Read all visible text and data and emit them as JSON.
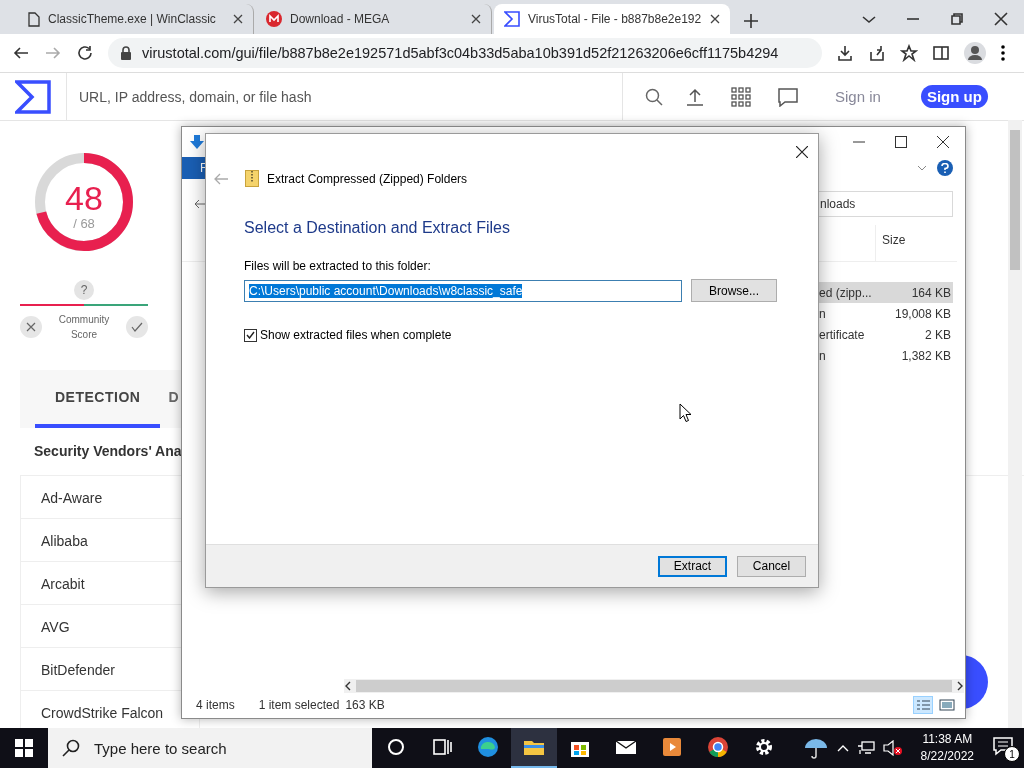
{
  "browser": {
    "tabs": [
      {
        "title": "ClassicTheme.exe | WinClassic",
        "kind": "page",
        "selected": false
      },
      {
        "title": "Download - MEGA",
        "kind": "mega",
        "selected": false
      },
      {
        "title": "VirusTotal - File - b887b8e2e192",
        "kind": "vt",
        "selected": true
      }
    ],
    "url": "virustotal.com/gui/file/b887b8e2e192571d5abf3c04b33d5aba10b391d52f21263206e6cff1175b4294"
  },
  "vt": {
    "search": {
      "placeholder": "URL, IP address, domain, or file hash"
    },
    "sign_in": "Sign in",
    "sign_up": "Sign up",
    "score": {
      "detections": "48",
      "total": "/ 68",
      "level": 0.71
    },
    "community": {
      "badge": "?",
      "label": "Community Score"
    },
    "tabs": [
      {
        "label": "DETECTION",
        "selected": true
      },
      {
        "label": "D",
        "selected": false
      }
    ],
    "section_title": "Security Vendors' Ana",
    "vendors": [
      "Ad-Aware",
      "Alibaba",
      "Arcabit",
      "AVG",
      "BitDefender",
      "CrowdStrike Falcon"
    ]
  },
  "explorer": {
    "ribbon_tab": "F",
    "search": {
      "value": "nloads"
    },
    "column": "Size",
    "rows": [
      {
        "name": "ed (zipp...",
        "size": "164 KB",
        "selected": true
      },
      {
        "name": "n",
        "size": "19,008 KB",
        "selected": false
      },
      {
        "name": "ertificate",
        "size": "2 KB",
        "selected": false
      },
      {
        "name": "n",
        "size": "1,382 KB",
        "selected": false
      }
    ],
    "status": {
      "items": "4 items",
      "selected": "1 item selected",
      "size": "163 KB"
    }
  },
  "dialog": {
    "title": "Extract Compressed (Zipped) Folders",
    "heading": "Select a Destination and Extract Files",
    "field_label": "Files will be extracted to this folder:",
    "path": {
      "value": "C:\\Users\\public account\\Downloads\\w8classic_safe",
      "text_selected": true
    },
    "browse": "Browse...",
    "checkbox": {
      "label": "Show extracted files when complete",
      "checked": true
    },
    "buttons": [
      {
        "label": "Extract",
        "default": true
      },
      {
        "label": "Cancel",
        "default": false
      }
    ]
  },
  "taskbar": {
    "search_placeholder": "Type here to search",
    "apps": [
      {
        "kind": "cortana",
        "active": false
      },
      {
        "kind": "taskview",
        "active": false
      },
      {
        "kind": "edge",
        "active": false
      },
      {
        "kind": "explorer",
        "active": true
      },
      {
        "kind": "store",
        "active": false
      },
      {
        "kind": "mail",
        "active": false
      },
      {
        "kind": "media",
        "active": false
      },
      {
        "kind": "chrome",
        "active": false
      },
      {
        "kind": "settings",
        "active": false
      }
    ],
    "time": "11:38 AM",
    "date": "8/22/2022",
    "notifications": "1"
  }
}
